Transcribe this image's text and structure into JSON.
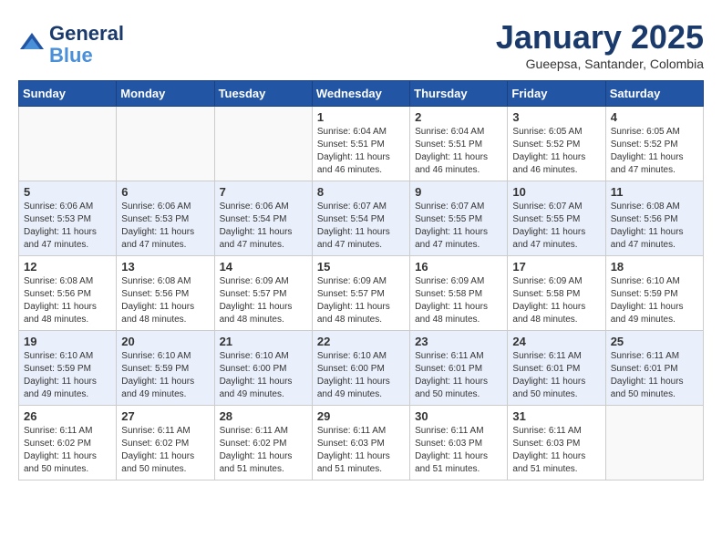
{
  "header": {
    "logo_line1": "General",
    "logo_line2": "Blue",
    "month": "January 2025",
    "location": "Gueepsa, Santander, Colombia"
  },
  "weekdays": [
    "Sunday",
    "Monday",
    "Tuesday",
    "Wednesday",
    "Thursday",
    "Friday",
    "Saturday"
  ],
  "weeks": [
    [
      {
        "day": "",
        "sunrise": "",
        "sunset": "",
        "daylight": ""
      },
      {
        "day": "",
        "sunrise": "",
        "sunset": "",
        "daylight": ""
      },
      {
        "day": "",
        "sunrise": "",
        "sunset": "",
        "daylight": ""
      },
      {
        "day": "1",
        "sunrise": "Sunrise: 6:04 AM",
        "sunset": "Sunset: 5:51 PM",
        "daylight": "Daylight: 11 hours and 46 minutes."
      },
      {
        "day": "2",
        "sunrise": "Sunrise: 6:04 AM",
        "sunset": "Sunset: 5:51 PM",
        "daylight": "Daylight: 11 hours and 46 minutes."
      },
      {
        "day": "3",
        "sunrise": "Sunrise: 6:05 AM",
        "sunset": "Sunset: 5:52 PM",
        "daylight": "Daylight: 11 hours and 46 minutes."
      },
      {
        "day": "4",
        "sunrise": "Sunrise: 6:05 AM",
        "sunset": "Sunset: 5:52 PM",
        "daylight": "Daylight: 11 hours and 47 minutes."
      }
    ],
    [
      {
        "day": "5",
        "sunrise": "Sunrise: 6:06 AM",
        "sunset": "Sunset: 5:53 PM",
        "daylight": "Daylight: 11 hours and 47 minutes."
      },
      {
        "day": "6",
        "sunrise": "Sunrise: 6:06 AM",
        "sunset": "Sunset: 5:53 PM",
        "daylight": "Daylight: 11 hours and 47 minutes."
      },
      {
        "day": "7",
        "sunrise": "Sunrise: 6:06 AM",
        "sunset": "Sunset: 5:54 PM",
        "daylight": "Daylight: 11 hours and 47 minutes."
      },
      {
        "day": "8",
        "sunrise": "Sunrise: 6:07 AM",
        "sunset": "Sunset: 5:54 PM",
        "daylight": "Daylight: 11 hours and 47 minutes."
      },
      {
        "day": "9",
        "sunrise": "Sunrise: 6:07 AM",
        "sunset": "Sunset: 5:55 PM",
        "daylight": "Daylight: 11 hours and 47 minutes."
      },
      {
        "day": "10",
        "sunrise": "Sunrise: 6:07 AM",
        "sunset": "Sunset: 5:55 PM",
        "daylight": "Daylight: 11 hours and 47 minutes."
      },
      {
        "day": "11",
        "sunrise": "Sunrise: 6:08 AM",
        "sunset": "Sunset: 5:56 PM",
        "daylight": "Daylight: 11 hours and 47 minutes."
      }
    ],
    [
      {
        "day": "12",
        "sunrise": "Sunrise: 6:08 AM",
        "sunset": "Sunset: 5:56 PM",
        "daylight": "Daylight: 11 hours and 48 minutes."
      },
      {
        "day": "13",
        "sunrise": "Sunrise: 6:08 AM",
        "sunset": "Sunset: 5:56 PM",
        "daylight": "Daylight: 11 hours and 48 minutes."
      },
      {
        "day": "14",
        "sunrise": "Sunrise: 6:09 AM",
        "sunset": "Sunset: 5:57 PM",
        "daylight": "Daylight: 11 hours and 48 minutes."
      },
      {
        "day": "15",
        "sunrise": "Sunrise: 6:09 AM",
        "sunset": "Sunset: 5:57 PM",
        "daylight": "Daylight: 11 hours and 48 minutes."
      },
      {
        "day": "16",
        "sunrise": "Sunrise: 6:09 AM",
        "sunset": "Sunset: 5:58 PM",
        "daylight": "Daylight: 11 hours and 48 minutes."
      },
      {
        "day": "17",
        "sunrise": "Sunrise: 6:09 AM",
        "sunset": "Sunset: 5:58 PM",
        "daylight": "Daylight: 11 hours and 48 minutes."
      },
      {
        "day": "18",
        "sunrise": "Sunrise: 6:10 AM",
        "sunset": "Sunset: 5:59 PM",
        "daylight": "Daylight: 11 hours and 49 minutes."
      }
    ],
    [
      {
        "day": "19",
        "sunrise": "Sunrise: 6:10 AM",
        "sunset": "Sunset: 5:59 PM",
        "daylight": "Daylight: 11 hours and 49 minutes."
      },
      {
        "day": "20",
        "sunrise": "Sunrise: 6:10 AM",
        "sunset": "Sunset: 5:59 PM",
        "daylight": "Daylight: 11 hours and 49 minutes."
      },
      {
        "day": "21",
        "sunrise": "Sunrise: 6:10 AM",
        "sunset": "Sunset: 6:00 PM",
        "daylight": "Daylight: 11 hours and 49 minutes."
      },
      {
        "day": "22",
        "sunrise": "Sunrise: 6:10 AM",
        "sunset": "Sunset: 6:00 PM",
        "daylight": "Daylight: 11 hours and 49 minutes."
      },
      {
        "day": "23",
        "sunrise": "Sunrise: 6:11 AM",
        "sunset": "Sunset: 6:01 PM",
        "daylight": "Daylight: 11 hours and 50 minutes."
      },
      {
        "day": "24",
        "sunrise": "Sunrise: 6:11 AM",
        "sunset": "Sunset: 6:01 PM",
        "daylight": "Daylight: 11 hours and 50 minutes."
      },
      {
        "day": "25",
        "sunrise": "Sunrise: 6:11 AM",
        "sunset": "Sunset: 6:01 PM",
        "daylight": "Daylight: 11 hours and 50 minutes."
      }
    ],
    [
      {
        "day": "26",
        "sunrise": "Sunrise: 6:11 AM",
        "sunset": "Sunset: 6:02 PM",
        "daylight": "Daylight: 11 hours and 50 minutes."
      },
      {
        "day": "27",
        "sunrise": "Sunrise: 6:11 AM",
        "sunset": "Sunset: 6:02 PM",
        "daylight": "Daylight: 11 hours and 50 minutes."
      },
      {
        "day": "28",
        "sunrise": "Sunrise: 6:11 AM",
        "sunset": "Sunset: 6:02 PM",
        "daylight": "Daylight: 11 hours and 51 minutes."
      },
      {
        "day": "29",
        "sunrise": "Sunrise: 6:11 AM",
        "sunset": "Sunset: 6:03 PM",
        "daylight": "Daylight: 11 hours and 51 minutes."
      },
      {
        "day": "30",
        "sunrise": "Sunrise: 6:11 AM",
        "sunset": "Sunset: 6:03 PM",
        "daylight": "Daylight: 11 hours and 51 minutes."
      },
      {
        "day": "31",
        "sunrise": "Sunrise: 6:11 AM",
        "sunset": "Sunset: 6:03 PM",
        "daylight": "Daylight: 11 hours and 51 minutes."
      },
      {
        "day": "",
        "sunrise": "",
        "sunset": "",
        "daylight": ""
      }
    ]
  ]
}
